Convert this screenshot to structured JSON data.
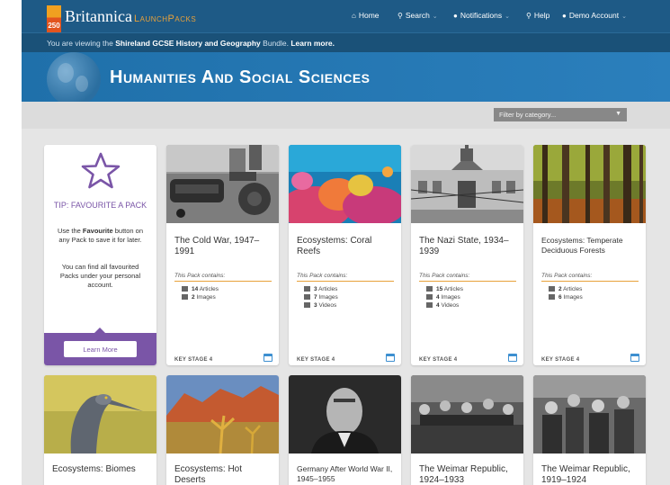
{
  "brand": {
    "badge": "250",
    "name": "Britannica",
    "product": "LaunchPacks"
  },
  "nav": {
    "home": "Home",
    "search": "Search",
    "notifications": "Notifications",
    "help": "Help",
    "account": "Demo Account"
  },
  "bundle": {
    "prefix": "You are viewing the ",
    "name": "Shireland GCSE History and Geography",
    "suffix": " Bundle. ",
    "link": "Learn more."
  },
  "hero": {
    "title": "Humanities And Social Sciences"
  },
  "filter": {
    "placeholder": "Filter by category..."
  },
  "tip": {
    "title": "TIP: FAVOURITE A PACK",
    "text1_pre": "Use the ",
    "text1_bold": "Favourite",
    "text1_post": " button on any Pack to save it for later.",
    "text2": "You can find all favourited Packs under your personal account.",
    "button": "Learn More"
  },
  "contains_label": "This Pack contains:",
  "cards": [
    {
      "title": "The Cold War, 1947–1991",
      "articles": "14",
      "images": "2",
      "videos": null,
      "key_stage": "KEY STAGE 4"
    },
    {
      "title": "Ecosystems: Coral Reefs",
      "articles": "3",
      "images": "7",
      "videos": "3",
      "key_stage": "KEY STAGE 4"
    },
    {
      "title": "The Nazi State, 1934–1939",
      "articles": "15",
      "images": "4",
      "videos": "4",
      "key_stage": "KEY STAGE 4"
    },
    {
      "title": "Ecosystems: Temperate Deciduous Forests",
      "articles": "2",
      "images": "6",
      "videos": null,
      "key_stage": "KEY STAGE 4"
    }
  ],
  "stat_labels": {
    "articles": "Articles",
    "images": "Images",
    "videos": "Videos"
  },
  "row2": [
    {
      "title": "Ecosystems: Biomes"
    },
    {
      "title": "Ecosystems: Hot Deserts"
    },
    {
      "title": "Germany After World War II, 1945–1955"
    },
    {
      "title": "The Weimar Republic, 1924–1933"
    },
    {
      "title": "The Weimar Republic, 1919–1924"
    }
  ],
  "icons": [
    "home-icon",
    "search-icon",
    "chat-icon",
    "help-icon",
    "user-icon",
    "star-icon",
    "calendar-icon",
    "article-icon",
    "image-icon",
    "video-icon"
  ]
}
